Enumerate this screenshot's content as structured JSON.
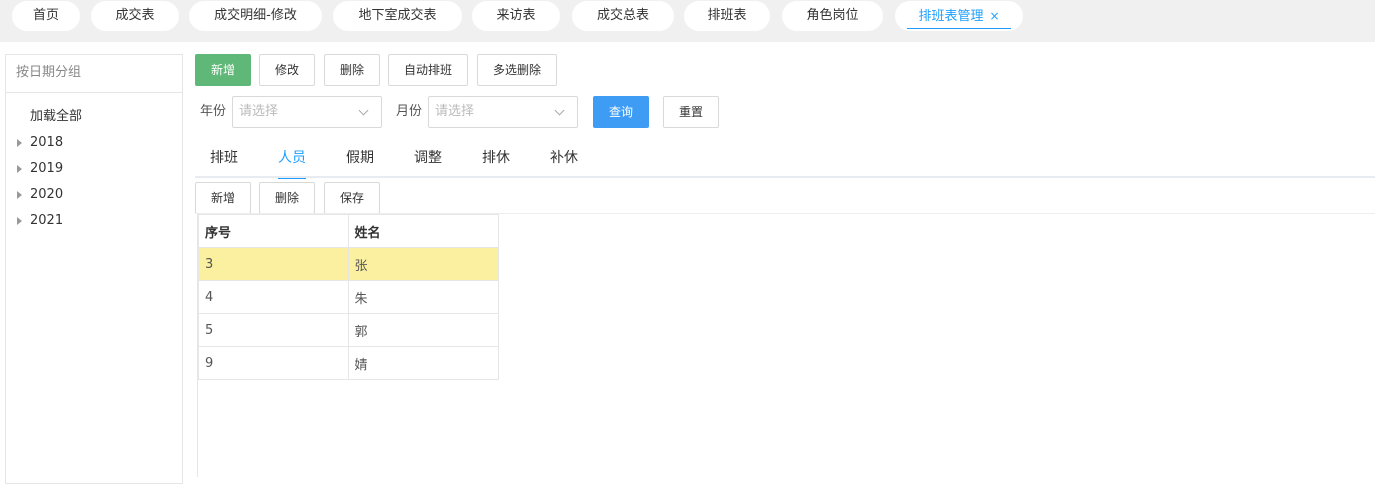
{
  "top_tabs": [
    {
      "label": "首页"
    },
    {
      "label": "成交表"
    },
    {
      "label": "成交明细-修改"
    },
    {
      "label": "地下室成交表"
    },
    {
      "label": "来访表"
    },
    {
      "label": "成交总表"
    },
    {
      "label": "排班表"
    },
    {
      "label": "角色岗位"
    },
    {
      "label": "排班表管理",
      "active": true,
      "close": "×"
    }
  ],
  "sidebar": {
    "header": "按日期分组",
    "load_all": "加载全部",
    "years": [
      "2018",
      "2019",
      "2020",
      "2021"
    ]
  },
  "toolbar": {
    "add": "新增",
    "edit": "修改",
    "delete": "删除",
    "auto_schedule": "自动排班",
    "multi_delete": "多选删除"
  },
  "filters": {
    "year_label": "年份",
    "year_placeholder": "请选择",
    "month_label": "月份",
    "month_placeholder": "请选择",
    "query": "查询",
    "reset": "重置"
  },
  "sub_tabs": [
    "排班",
    "人员",
    "假期",
    "调整",
    "排休",
    "补休"
  ],
  "active_sub_tab": "人员",
  "sub_toolbar": {
    "add": "新增",
    "delete": "删除",
    "save": "保存"
  },
  "table": {
    "headers": [
      "序号",
      "姓名"
    ],
    "rows": [
      [
        "3",
        "张"
      ],
      [
        "4",
        "朱"
      ],
      [
        "5",
        "郭"
      ],
      [
        "9",
        "婧"
      ]
    ],
    "selected_row": 0
  },
  "colors": {
    "green": "#5fb878",
    "blue": "#3e9cf4",
    "active_tab": "#1e9fff",
    "selected_row": "#faf0a0"
  }
}
